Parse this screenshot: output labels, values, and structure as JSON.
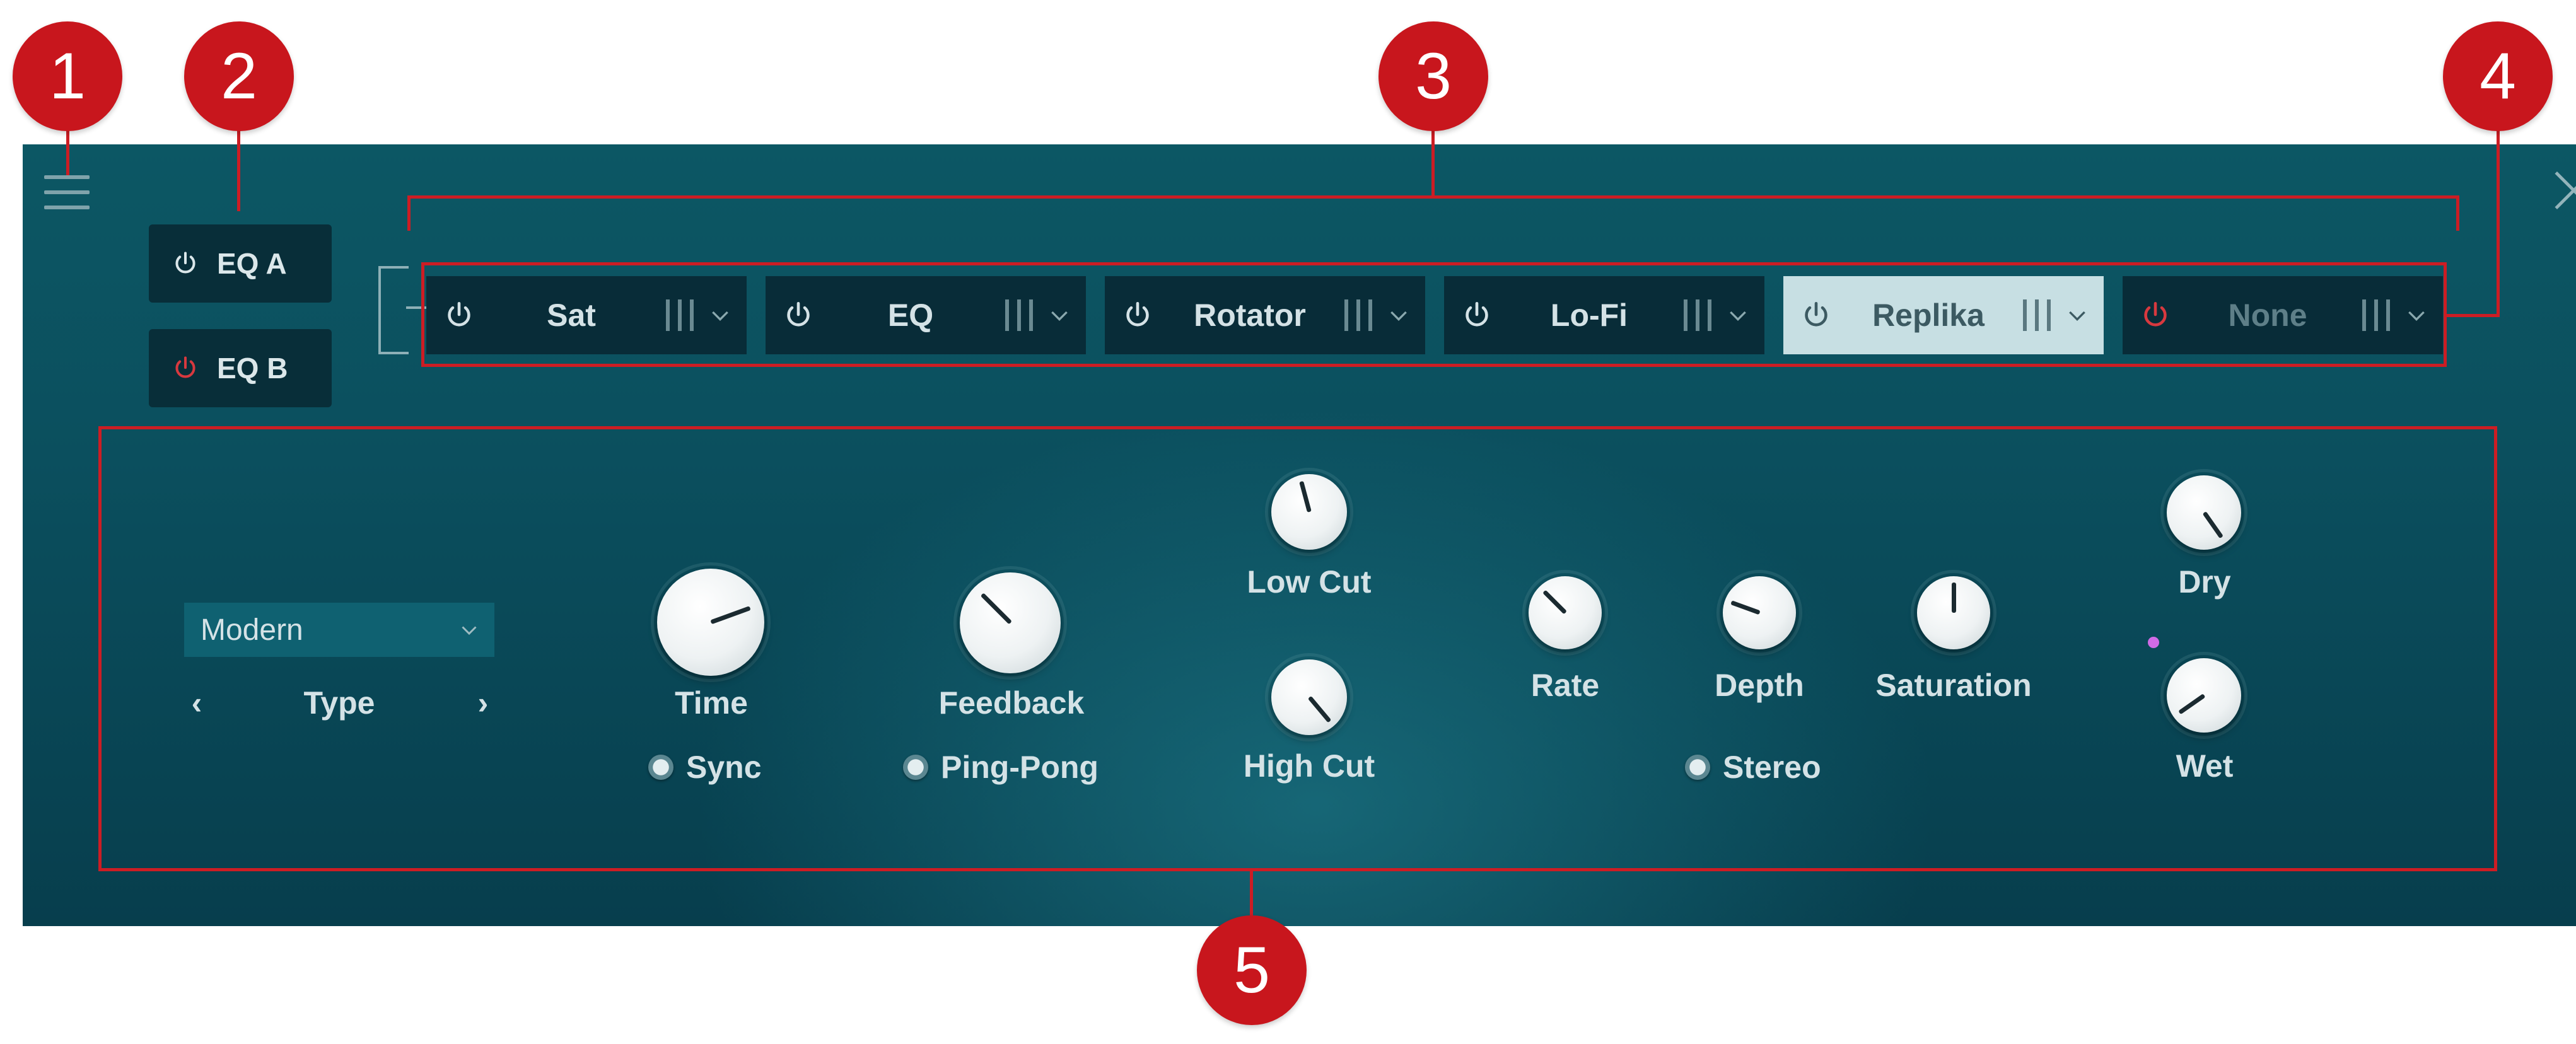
{
  "header": {
    "eq_buttons": [
      {
        "label": "EQ A",
        "power": "off"
      },
      {
        "label": "EQ B",
        "power": "on-red"
      }
    ]
  },
  "fx_slots": [
    {
      "label": "Sat",
      "state": "normal"
    },
    {
      "label": "EQ",
      "state": "normal"
    },
    {
      "label": "Rotator",
      "state": "normal"
    },
    {
      "label": "Lo-Fi",
      "state": "normal"
    },
    {
      "label": "Replika",
      "state": "selected"
    },
    {
      "label": "None",
      "state": "empty"
    }
  ],
  "replika": {
    "type_dropdown": {
      "value": "Modern",
      "label": "Type",
      "prev": "‹",
      "next": "›"
    },
    "knobs": {
      "time": "Time",
      "feedback": "Feedback",
      "low_cut": "Low Cut",
      "high_cut": "High Cut",
      "rate": "Rate",
      "depth": "Depth",
      "saturation": "Saturation",
      "dry": "Dry",
      "wet": "Wet"
    },
    "toggles": {
      "sync": "Sync",
      "ping_pong": "Ping-Pong",
      "stereo": "Stereo"
    }
  },
  "callouts": [
    "1",
    "2",
    "3",
    "4",
    "5"
  ],
  "colors": {
    "callout": "#c8161d",
    "panel": "#0b4f5e",
    "slot": "#082c38",
    "slot_selected": "#c7dfe3",
    "power_red": "#d7393f",
    "accent_dot": "#d06be6"
  },
  "icons": {
    "menu": "hamburger-menu-icon",
    "close": "close-icon",
    "power": "power-icon",
    "grip": "drag-handle-icon",
    "dropdown": "chevron-down-icon"
  }
}
